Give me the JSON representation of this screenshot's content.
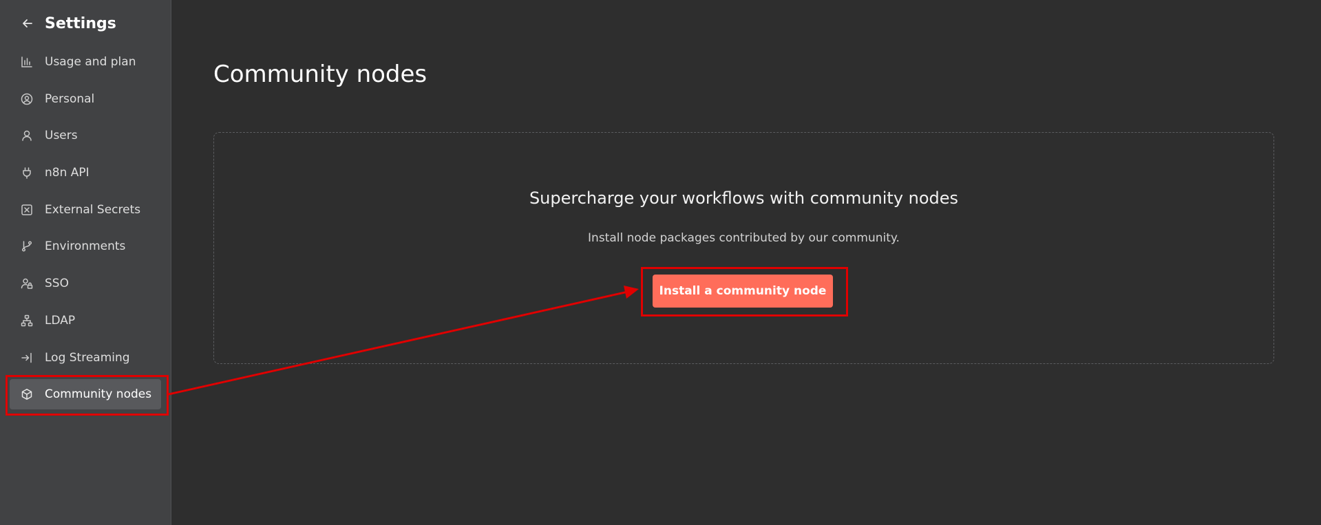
{
  "sidebar": {
    "title": "Settings",
    "back_icon": "arrow-left-icon",
    "items": [
      {
        "label": "Usage and plan",
        "icon": "bar-chart-icon"
      },
      {
        "label": "Personal",
        "icon": "user-circle-icon"
      },
      {
        "label": "Users",
        "icon": "user-icon"
      },
      {
        "label": "n8n API",
        "icon": "plug-icon"
      },
      {
        "label": "External Secrets",
        "icon": "square-x-icon"
      },
      {
        "label": "Environments",
        "icon": "git-branch-icon"
      },
      {
        "label": "SSO",
        "icon": "user-lock-icon"
      },
      {
        "label": "LDAP",
        "icon": "network-icon"
      },
      {
        "label": "Log Streaming",
        "icon": "log-in-icon"
      },
      {
        "label": "Community nodes",
        "icon": "box-icon",
        "active": true
      }
    ]
  },
  "main": {
    "title": "Community nodes",
    "empty_state": {
      "heading": "Supercharge your workflows with community nodes",
      "description": "Install node packages contributed by our community.",
      "button_label": "Install a community node"
    }
  },
  "colors": {
    "sidebar_bg": "#414244",
    "main_bg": "#2e2e2e",
    "accent": "#ff6d5a",
    "annotation": "#e00000"
  }
}
